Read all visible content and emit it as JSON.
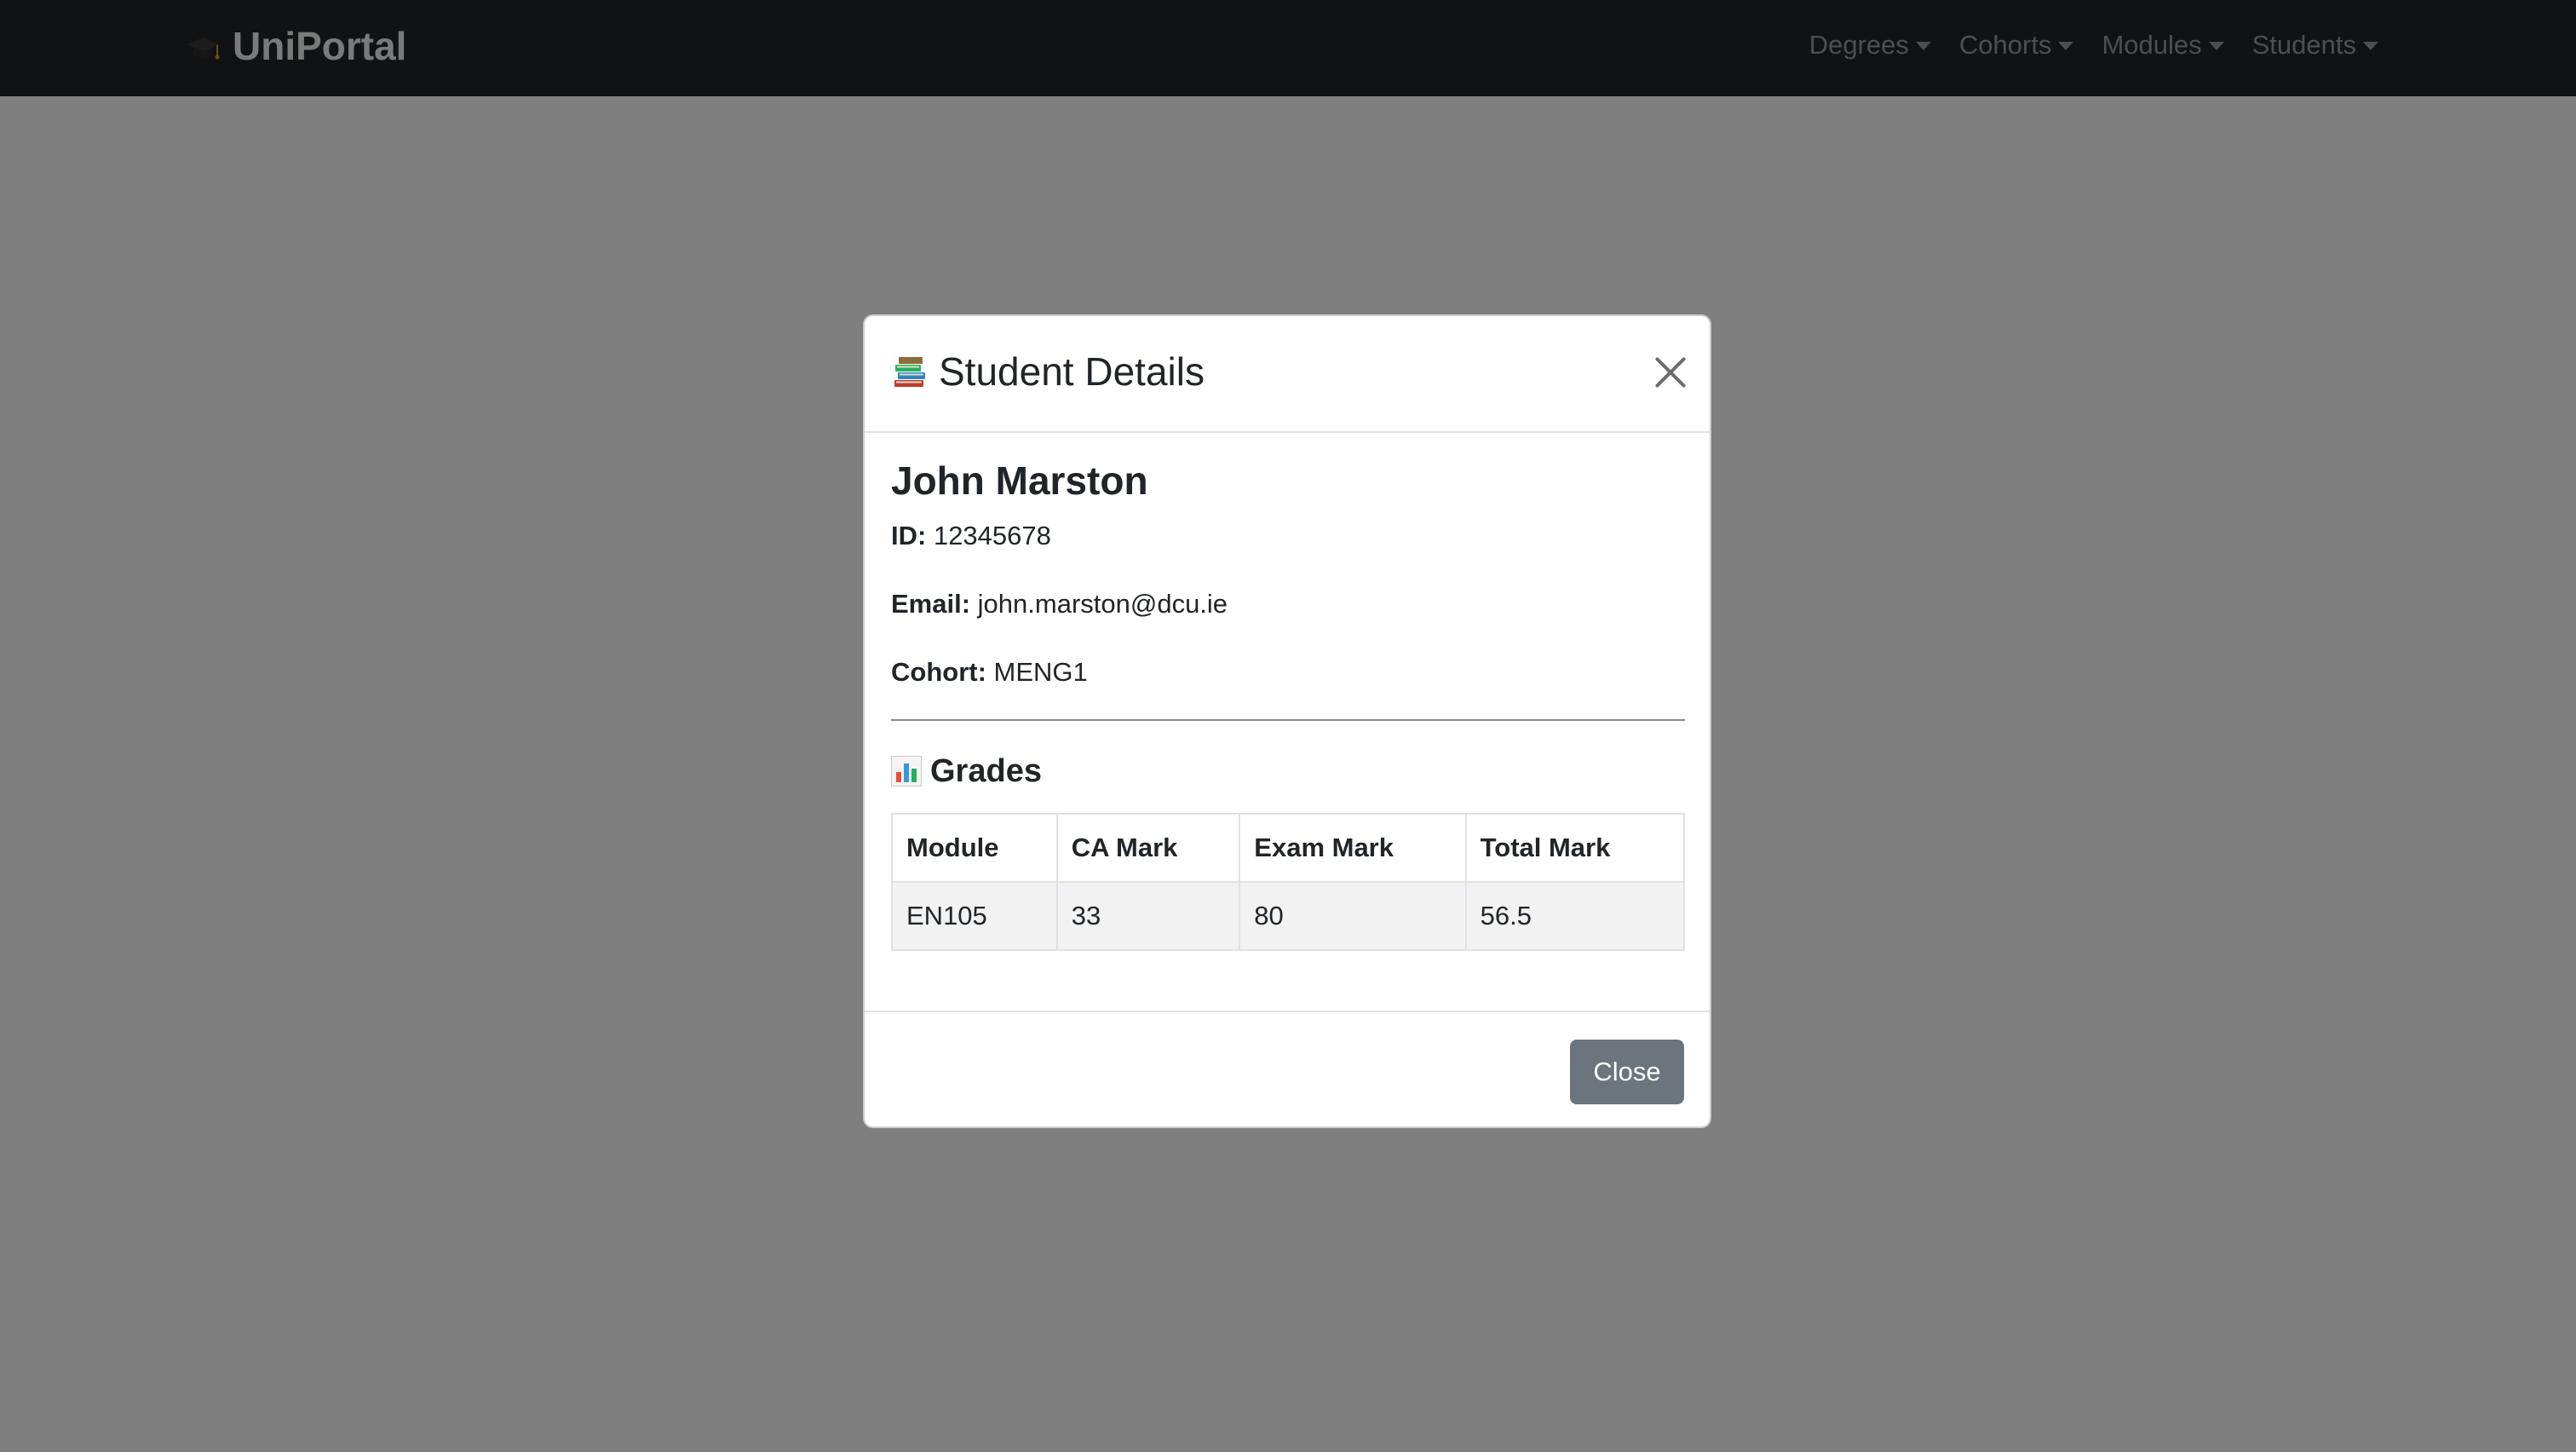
{
  "navbar": {
    "brand": "UniPortal",
    "brand_icon": "graduation-cap-icon",
    "menus": [
      {
        "label": "Degrees"
      },
      {
        "label": "Cohorts"
      },
      {
        "label": "Modules"
      },
      {
        "label": "Students"
      }
    ]
  },
  "modal": {
    "title": "Student Details",
    "title_icon": "books-icon",
    "close_icon": "close-icon",
    "student": {
      "name": "John Marston",
      "id_label": "ID:",
      "id_value": "12345678",
      "email_label": "Email:",
      "email_value": "john.marston@dcu.ie",
      "cohort_label": "Cohort:",
      "cohort_value": "MENG1"
    },
    "grades": {
      "title": "Grades",
      "title_icon": "bar-chart-icon",
      "columns": [
        "Module",
        "CA Mark",
        "Exam Mark",
        "Total Mark"
      ],
      "rows": [
        [
          "EN105",
          "33",
          "80",
          "56.5"
        ]
      ]
    },
    "footer": {
      "close_label": "Close"
    }
  },
  "colors": {
    "navbar_bg": "#212529",
    "backdrop": "rgba(0,0,0,0.5)",
    "close_button": "#6c757d"
  }
}
